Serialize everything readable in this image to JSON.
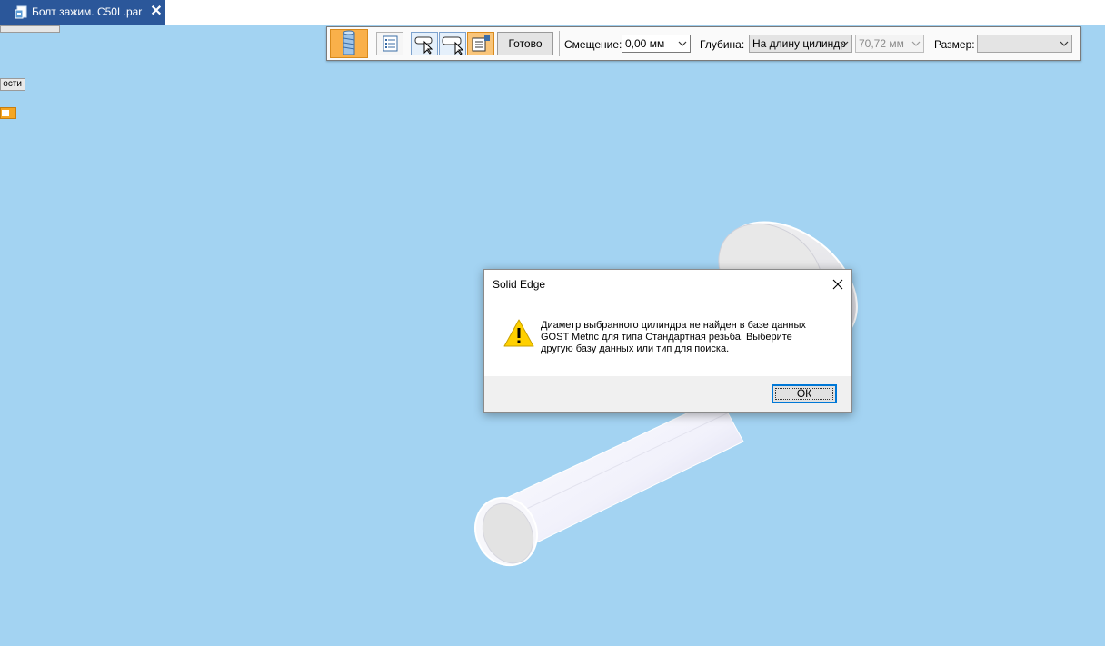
{
  "colors": {
    "background": "#a3d3f2",
    "tab_active": "#2b579a",
    "accent_orange": "#f9b04a",
    "dialog_footer": "#f0f0f0"
  },
  "tab": {
    "title": "Болт зажим. C50L.par",
    "file_icon": "part-file-icon",
    "close_icon": "close-icon"
  },
  "left_panel": {
    "button_label": "ости"
  },
  "commandbar": {
    "done_label": "Готово",
    "offset_label": "Смещение:",
    "offset_value": "0,00 мм",
    "depth_label": "Глубина:",
    "depth_value": "На длину цилиндр",
    "length_value": "70,72 мм",
    "size_label": "Размер:",
    "size_value": ""
  },
  "dialog": {
    "title": "Solid Edge",
    "icon": "warning-icon",
    "message_lines": [
      "Диаметр выбранного цилиндра не найден в базе данных",
      "GOST Metric для типа Стандартная резьба. Выберите",
      "другую базу данных или тип для поиска."
    ],
    "ok_label": "ОК"
  }
}
